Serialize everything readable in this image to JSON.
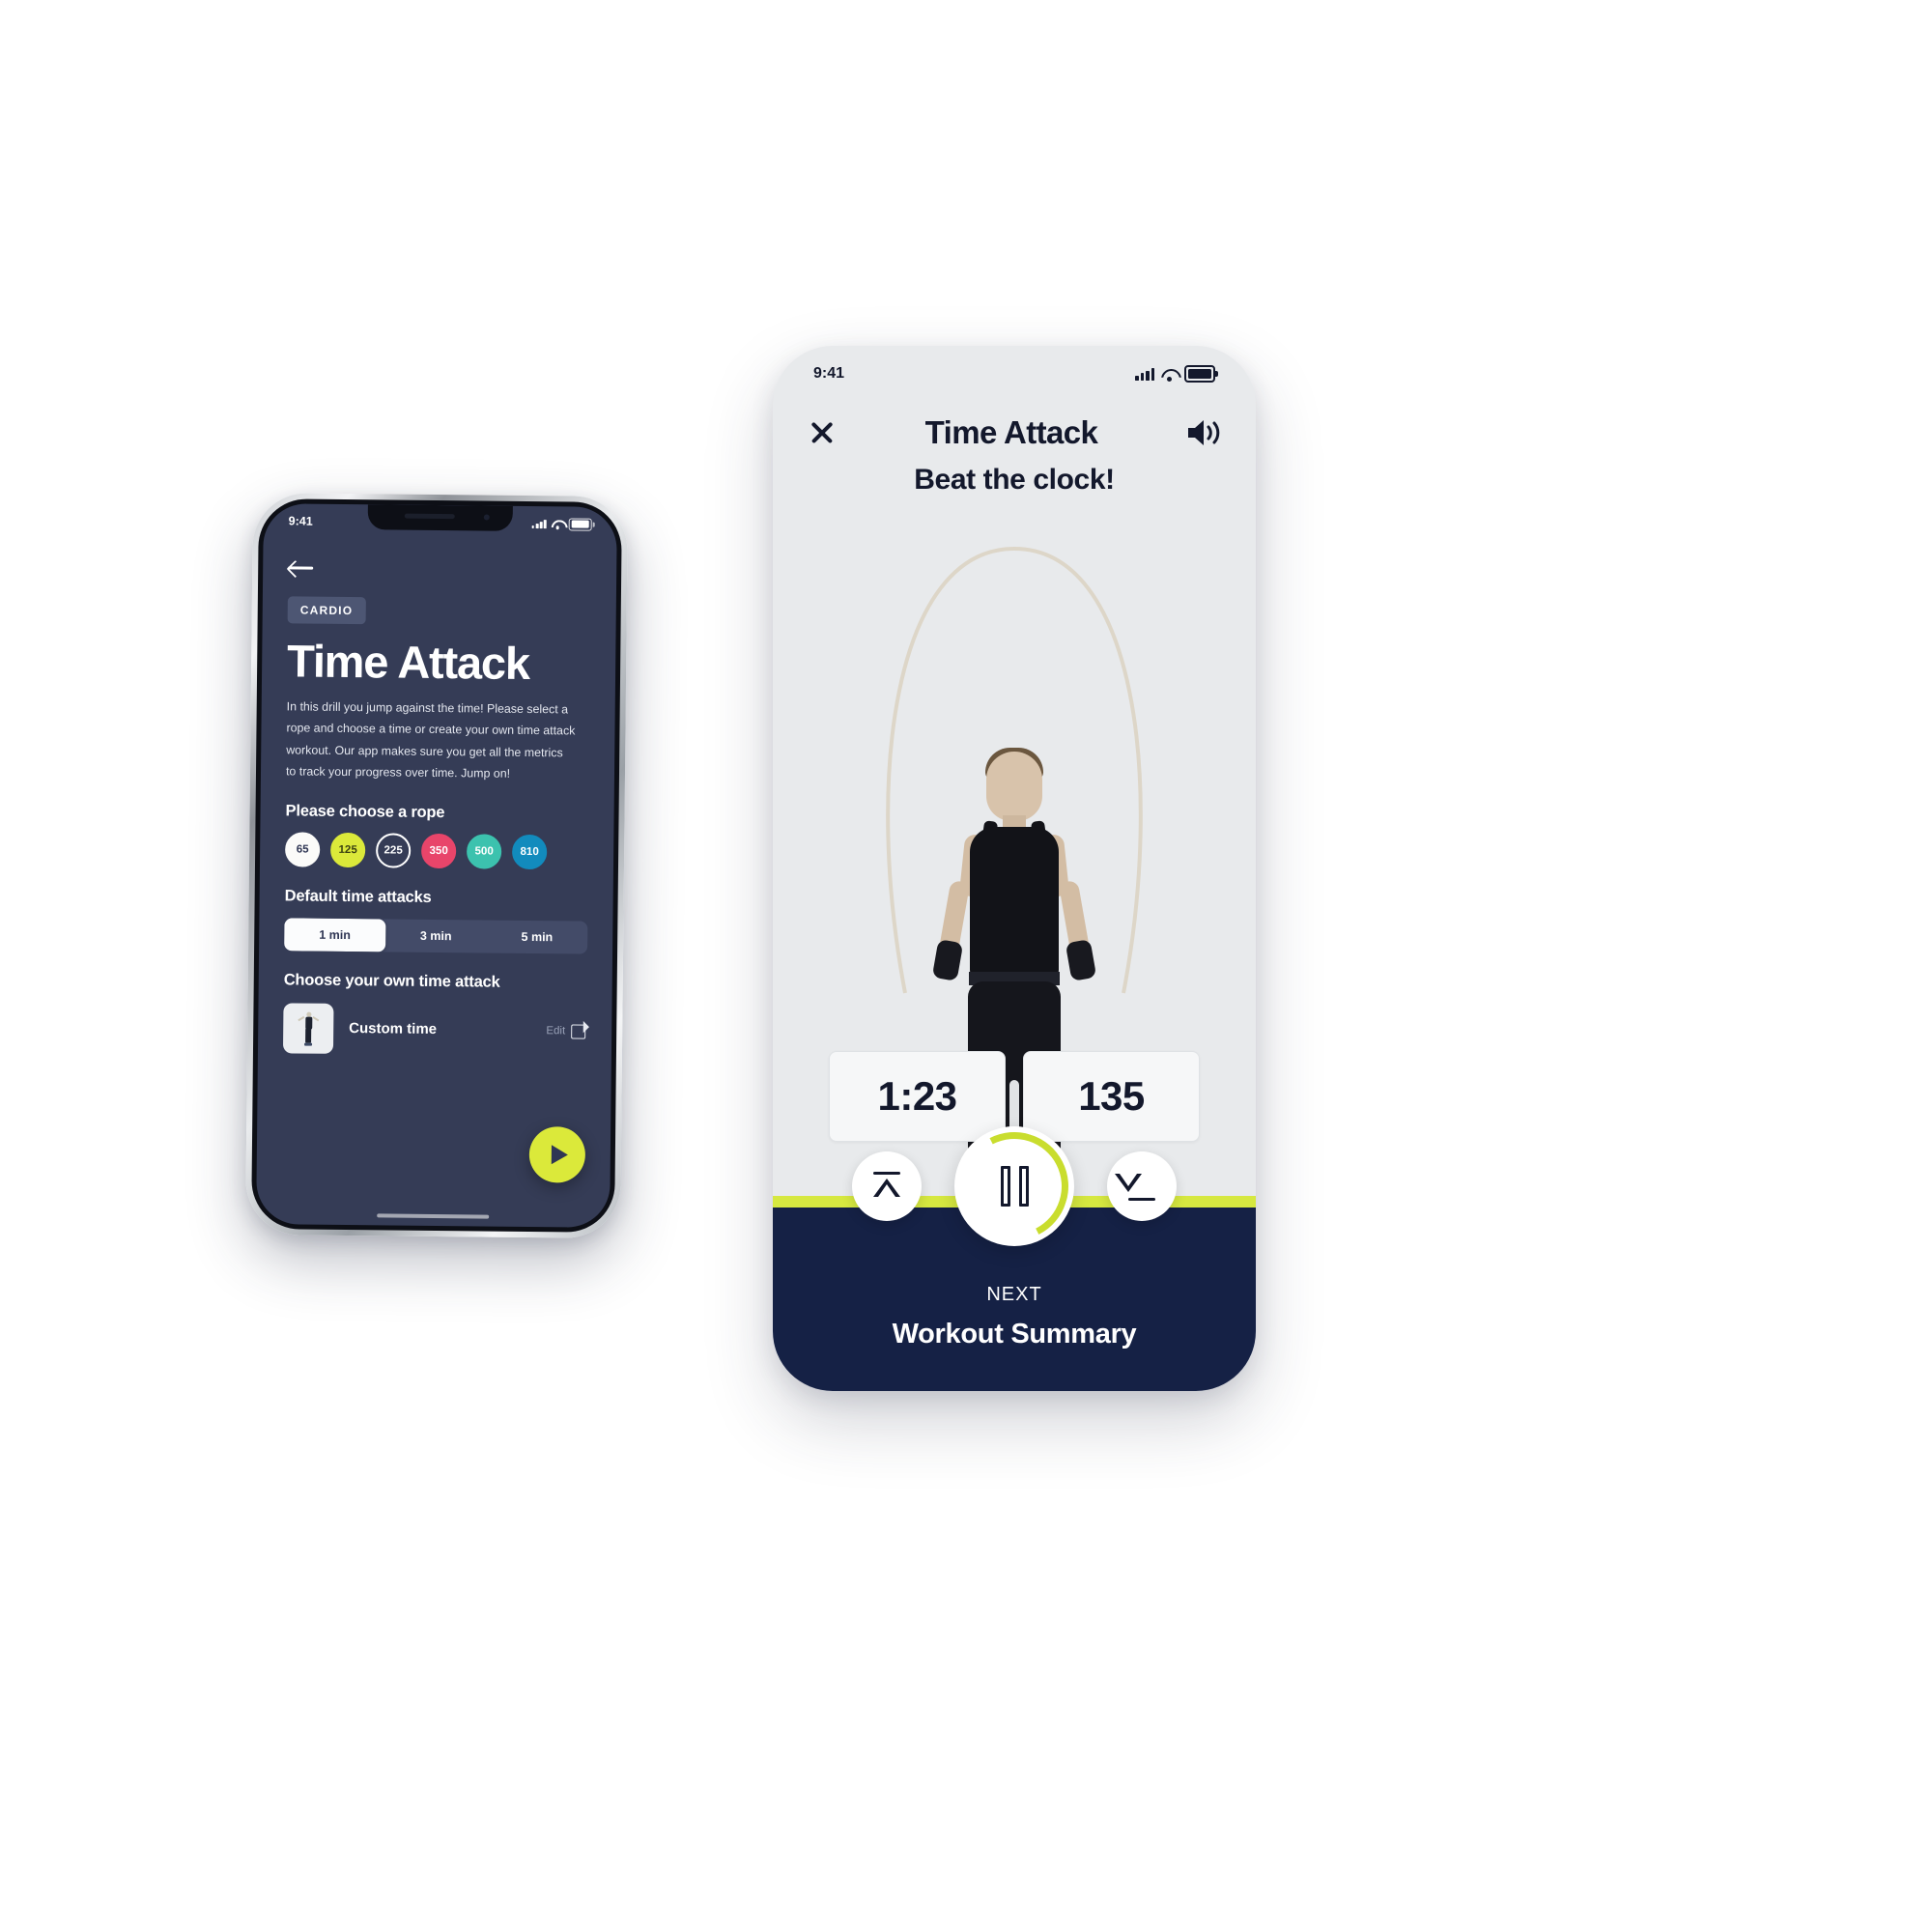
{
  "theme": {
    "dark_navy": "#353c56",
    "deep_navy": "#152145",
    "lime": "#d6e840",
    "light_bg": "#e8eaec"
  },
  "left_phone": {
    "status_bar": {
      "time": "9:41",
      "signal_icon": "cellular-signal-icon",
      "wifi_icon": "wifi-icon",
      "battery_icon": "battery-icon"
    },
    "back_icon": "back-arrow-icon",
    "category_chip": "CARDIO",
    "title": "Time Attack",
    "description": "In this drill you jump against the time! Please select a rope and choose a time or create your own time attack workout. Our app makes sure you get all the metrics to track your progress over time. Jump on!",
    "rope_section_title": "Please choose a rope",
    "ropes": [
      {
        "label": "65",
        "fill": "#fbfbf9",
        "text": "#2f3654",
        "border": "#fbfbf9",
        "selected": false
      },
      {
        "label": "125",
        "fill": "#dbe93a",
        "text": "#3b4112",
        "border": "#dbe93a",
        "selected": true
      },
      {
        "label": "225",
        "fill": "transparent",
        "text": "#ffffff",
        "border": "#ffffff",
        "selected": false
      },
      {
        "label": "350",
        "fill": "#e8456a",
        "text": "#ffffff",
        "border": "#e8456a",
        "selected": false
      },
      {
        "label": "500",
        "fill": "#3cc2ae",
        "text": "#ffffff",
        "border": "#3cc2ae",
        "selected": false
      },
      {
        "label": "810",
        "fill": "#128bbd",
        "text": "#ffffff",
        "border": "#128bbd",
        "selected": false
      }
    ],
    "default_section_title": "Default time attacks",
    "time_options": [
      {
        "label": "1 min",
        "active": true
      },
      {
        "label": "3 min",
        "active": false
      },
      {
        "label": "5 min",
        "active": false
      }
    ],
    "custom_section_title": "Choose your own time attack",
    "custom_item": {
      "label": "Custom time",
      "edit_label": "Edit",
      "edit_icon": "edit-pencil-icon",
      "thumbnail_icon": "jumping-person-thumbnail"
    },
    "play_button_icon": "play-icon"
  },
  "right_phone": {
    "status_bar": {
      "time": "9:41",
      "signal_icon": "cellular-signal-icon",
      "wifi_icon": "wifi-icon",
      "battery_icon": "battery-icon"
    },
    "close_icon": "close-x-icon",
    "title": "Time Attack",
    "sound_icon": "speaker-volume-icon",
    "subtitle": "Beat the clock!",
    "hero_image": "woman-jumping-rope-photo",
    "stats": [
      {
        "name": "elapsed-time",
        "value": "1:23"
      },
      {
        "name": "jump-count",
        "value": "135"
      }
    ],
    "controls": {
      "previous_icon": "skip-previous-icon",
      "pause_icon": "pause-icon",
      "next_icon": "skip-next-icon"
    },
    "footer": {
      "next_label": "NEXT",
      "next_value": "Workout Summary"
    }
  }
}
